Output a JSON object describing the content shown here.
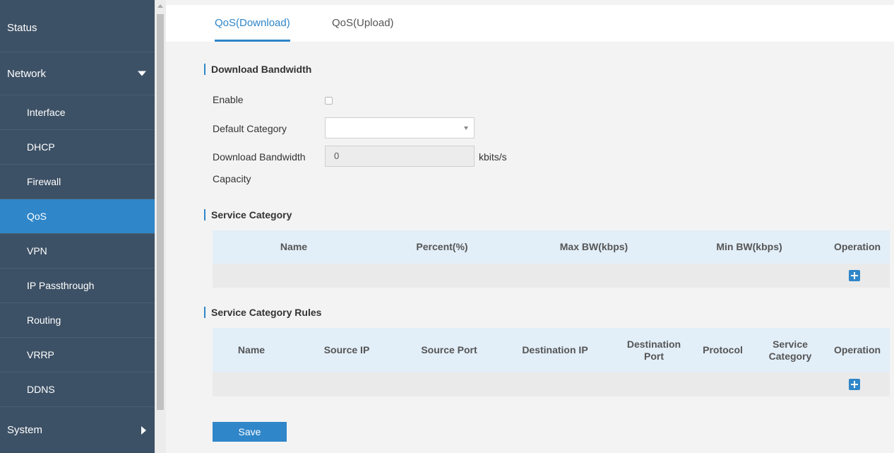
{
  "sidebar": {
    "status": "Status",
    "network": "Network",
    "items": [
      "Interface",
      "DHCP",
      "Firewall",
      "QoS",
      "VPN",
      "IP Passthrough",
      "Routing",
      "VRRP",
      "DDNS"
    ],
    "active_item": "QoS",
    "system": "System"
  },
  "tabs": [
    "QoS(Download)",
    "QoS(Upload)"
  ],
  "active_tab": "QoS(Download)",
  "download_bandwidth": {
    "title": "Download Bandwidth",
    "enable_label": "Enable",
    "enable_checked": false,
    "default_category_label": "Default Category",
    "default_category_value": "",
    "bandwidth_label_line1": "Download Bandwidth",
    "bandwidth_label_line2": "Capacity",
    "bandwidth_value": "0",
    "unit": "kbits/s"
  },
  "service_category": {
    "title": "Service Category",
    "columns": [
      "Name",
      "Percent(%)",
      "Max BW(kbps)",
      "Min BW(kbps)",
      "Operation"
    ],
    "add_icon": "plus-icon"
  },
  "service_category_rules": {
    "title": "Service Category Rules",
    "columns": [
      "Name",
      "Source IP",
      "Source Port",
      "Destination IP",
      "Destination Port",
      "Protocol",
      "Service Category",
      "Operation"
    ],
    "add_icon": "plus-icon"
  },
  "save_label": "Save",
  "colors": {
    "accent": "#2f86c9",
    "sidebar": "#3d5166",
    "table_header": "#e2eef8"
  }
}
